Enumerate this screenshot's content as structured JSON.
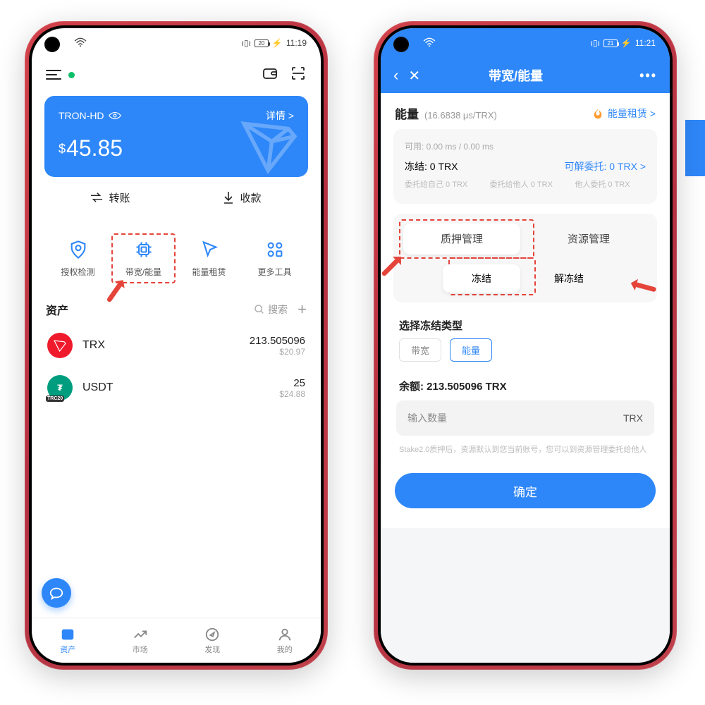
{
  "left": {
    "status_time": "11:19",
    "status_batt": "20",
    "card": {
      "network": "TRON-HD",
      "details": "详情 >",
      "currency": "$",
      "amount": "45.85"
    },
    "actions": {
      "transfer": "转账",
      "receive": "收款"
    },
    "tools": {
      "t1": "授权检测",
      "t2": "带宽/能量",
      "t3": "能量租赁",
      "t4": "更多工具"
    },
    "assets_title": "资产",
    "search_label": "搜索",
    "plus": "+",
    "assets": [
      {
        "sym": "TRX",
        "amt": "213.505096",
        "usd": "$20.97"
      },
      {
        "sym": "USDT",
        "amt": "25",
        "usd": "$24.88"
      }
    ],
    "nav": {
      "n1": "资产",
      "n2": "市场",
      "n3": "发现",
      "n4": "我的"
    }
  },
  "right": {
    "status_time": "11:21",
    "status_batt": "21",
    "title": "带宽/能量",
    "energy_label": "能量",
    "energy_rate": "(16.6838 μs/TRX)",
    "rent_link": "能量租赁 >",
    "avail": "可用: 0.00 ms / 0.00 ms",
    "frozen": "冻结: 0 TRX",
    "delegate": "可解委托: 0 TRX >",
    "col1": "委托给自己 0 TRX",
    "col2": "委托给他人 0 TRX",
    "col3": "他人委托 0 TRX",
    "seg1": "质押管理",
    "seg2": "资源管理",
    "sub1": "冻结",
    "sub2": "解冻结",
    "freeze_type_label": "选择冻结类型",
    "chip1": "带宽",
    "chip2": "能量",
    "bal_prefix": "余额: ",
    "bal_val": "213.505096 TRX",
    "input_placeholder": "输入数量",
    "input_suffix": "TRX",
    "hint": "Stake2.0质押后，资源默认到您当前账号，您可以到资源管理委托给他人",
    "confirm": "确定"
  }
}
